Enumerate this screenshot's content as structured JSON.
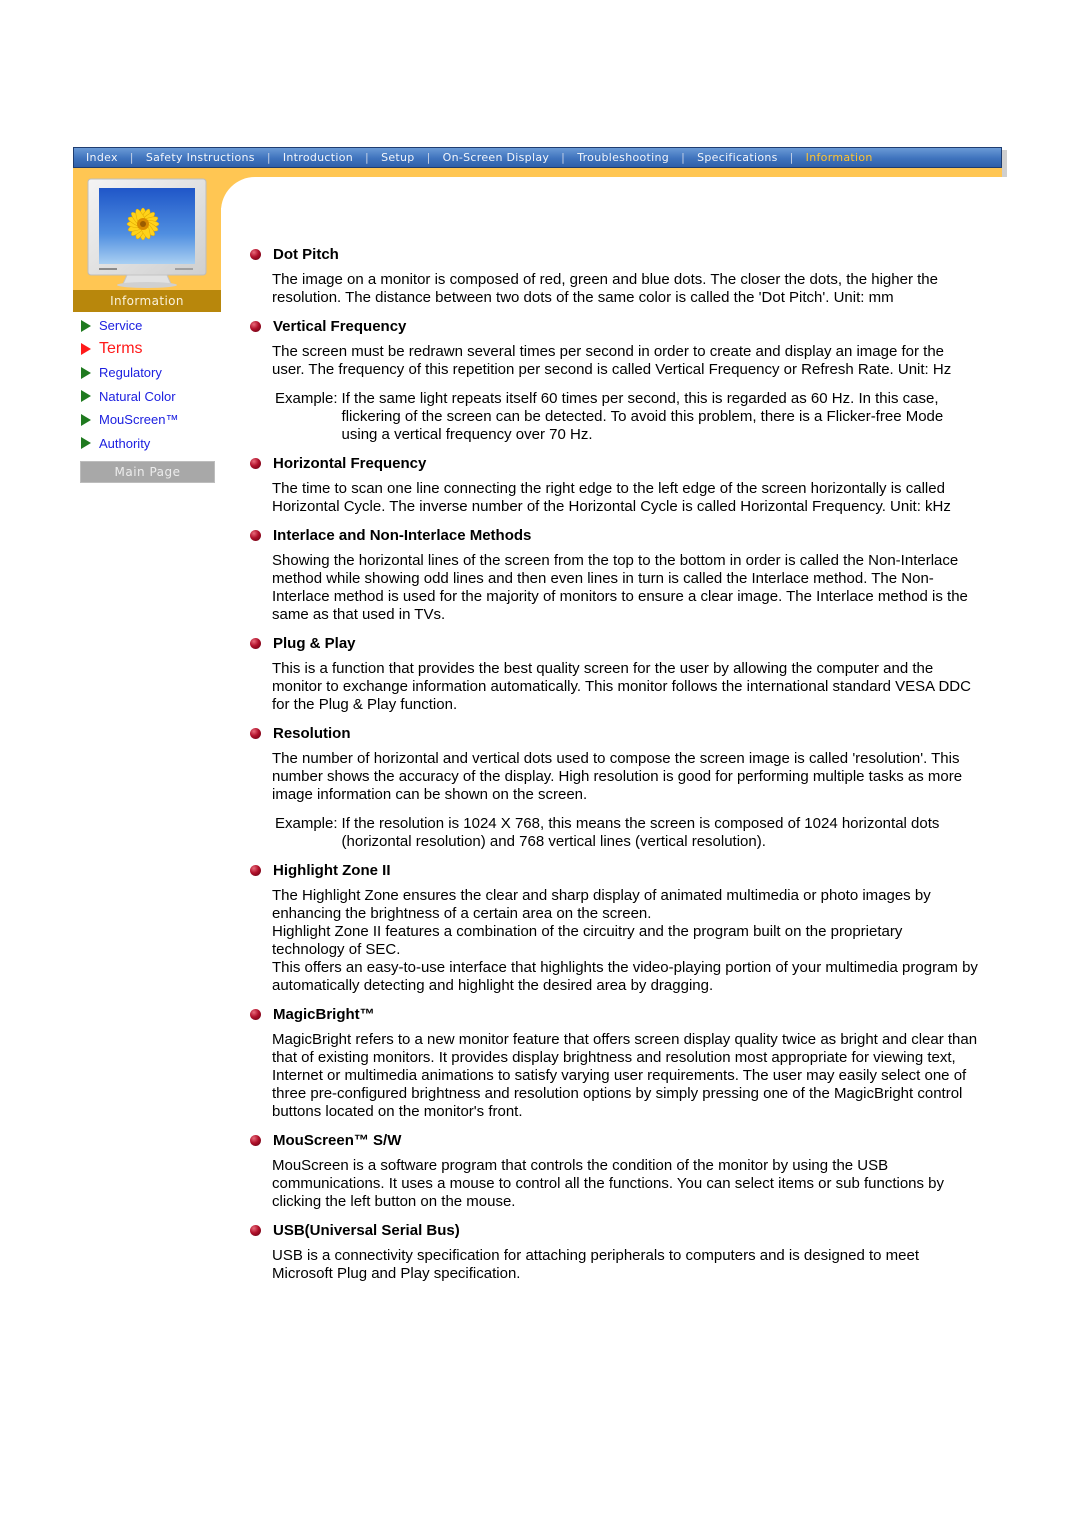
{
  "nav": {
    "items": [
      {
        "label": "Index",
        "active": false
      },
      {
        "label": "Safety Instructions",
        "active": false
      },
      {
        "label": "Introduction",
        "active": false
      },
      {
        "label": "Setup",
        "active": false
      },
      {
        "label": "On-Screen Display",
        "active": false
      },
      {
        "label": "Troubleshooting",
        "active": false
      },
      {
        "label": "Specifications",
        "active": false
      },
      {
        "label": "Information",
        "active": true
      }
    ],
    "separator": "|"
  },
  "sidebar": {
    "section_label": "Information",
    "links": [
      {
        "label": "Service",
        "active": false
      },
      {
        "label": "Terms",
        "active": true
      },
      {
        "label": "Regulatory",
        "active": false
      },
      {
        "label": "Natural Color",
        "active": false
      },
      {
        "label": "MouScreen™",
        "active": false
      },
      {
        "label": "Authority",
        "active": false
      }
    ],
    "main_page_label": "Main Page"
  },
  "colors": {
    "nav_blue": "#3f73bd",
    "nav_active": "#ffc22e",
    "orange": "#ffc653",
    "info_band": "#b8870c",
    "link_blue": "#1d20e0",
    "link_active": "#ff1a1a",
    "bullet_red": "#b0102a"
  },
  "sections": [
    {
      "title": "Dot Pitch",
      "paragraphs": [
        "The image on a monitor is composed of red, green and blue dots. The closer the dots, the higher the resolution. The distance between two dots of the same color is called the 'Dot Pitch'. Unit: mm"
      ]
    },
    {
      "title": "Vertical Frequency",
      "paragraphs": [
        "The screen must be redrawn several times per second in order to create and display an image for the user. The frequency of this repetition per second is called Vertical Frequency or Refresh Rate. Unit: Hz"
      ],
      "example": {
        "label": "Example:",
        "text": "If the same light repeats itself 60 times per second, this is regarded as 60 Hz. In this case, flickering of the screen can be detected. To avoid this problem, there is a Flicker-free Mode using a vertical frequency over 70 Hz."
      }
    },
    {
      "title": "Horizontal Frequency",
      "paragraphs": [
        "The time to scan one line connecting the right edge to the left edge of the screen horizontally is called Horizontal Cycle. The inverse number of the Horizontal Cycle is called Horizontal Frequency. Unit: kHz"
      ]
    },
    {
      "title": "Interlace and Non-Interlace Methods",
      "paragraphs": [
        "Showing the horizontal lines of the screen from the top to the bottom in order is called the Non-Interlace method while showing odd lines and then even lines in turn is called the Interlace method. The Non-Interlace method is used for the majority of monitors to ensure a clear image. The Interlace method is the same as that used in TVs."
      ]
    },
    {
      "title": "Plug & Play",
      "paragraphs": [
        "This is a function that provides the best quality screen for the user by allowing the computer and the monitor to exchange information automatically. This monitor follows the international standard VESA DDC for the Plug & Play function."
      ]
    },
    {
      "title": "Resolution",
      "paragraphs": [
        "The number of horizontal and vertical dots used to compose the screen image is called 'resolution'. This number shows the accuracy of the display. High resolution is good for performing multiple tasks as more image information can be shown on the screen."
      ],
      "example": {
        "label": "Example:",
        "text": "If the resolution is 1024 X 768, this means the screen is composed of 1024 horizontal dots (horizontal resolution) and 768 vertical lines (vertical resolution)."
      }
    },
    {
      "title": "Highlight Zone II",
      "paragraphs": [
        "The Highlight Zone ensures the clear and sharp display of animated multimedia or photo images by enhancing the brightness of a certain area on the screen.",
        "Highlight Zone II features a combination of the circuitry and the program built on the proprietary technology of SEC.",
        "This offers an easy-to-use interface that highlights the video-playing portion of your multimedia program by automatically detecting and highlight the desired area by dragging."
      ]
    },
    {
      "title": "MagicBright™",
      "paragraphs": [
        "MagicBright refers to a new monitor feature that offers screen display quality twice as bright and clear than that of existing monitors. It provides display brightness and resolution most appropriate for viewing text, Internet or multimedia animations to satisfy varying user requirements. The user may easily select one of three pre-configured brightness and resolution options by simply pressing one of the MagicBright control buttons located on the monitor's front."
      ]
    },
    {
      "title": "MouScreen™ S/W",
      "paragraphs": [
        "MouScreen is a software program that controls the condition of the monitor by using the USB communications. It uses a mouse to control all the functions. You can select items or sub functions by clicking the left button on the mouse."
      ]
    },
    {
      "title": "USB(Universal Serial Bus)",
      "paragraphs": [
        "USB is a connectivity specification for attaching peripherals to computers and is designed to meet Microsoft Plug and Play specification."
      ]
    }
  ]
}
